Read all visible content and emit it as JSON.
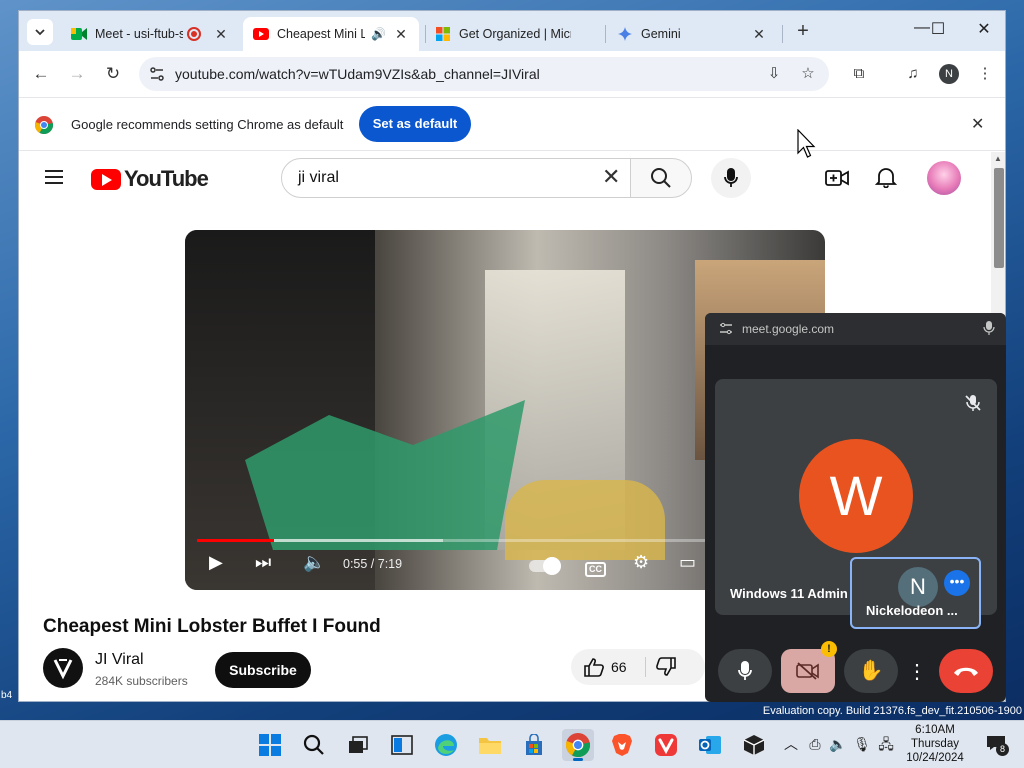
{
  "browser": {
    "tabs": [
      {
        "label": "Meet - usi-ftub-s",
        "active": false
      },
      {
        "label": "Cheapest Mini Lo",
        "active": true
      },
      {
        "label": "Get Organized | Micr",
        "active": false
      },
      {
        "label": "Gemini",
        "active": false
      }
    ],
    "new_tab": "+",
    "url": "youtube.com/watch?v=wTUdam9VZIs&ab_channel=JIViral",
    "profile_initial": "N",
    "infobar": {
      "message": "Google recommends setting Chrome as default",
      "button": "Set as default"
    }
  },
  "youtube": {
    "search_value": "ji viral",
    "player": {
      "time": "0:55 / 7:19",
      "progress_fraction": 0.125,
      "buffer_fraction": 0.4
    },
    "video_title": "Cheapest Mini Lobster Buffet I Found",
    "channel_name": "JI Viral",
    "subscribers": "284K subscribers",
    "subscribe_label": "Subscribe",
    "likes": "66"
  },
  "meet_pip": {
    "origin": "meet.google.com",
    "main_tile": {
      "initial": "W",
      "name": "Windows 11 Admin"
    },
    "self_tile": {
      "initial": "N",
      "name": "Nickelodeon ...",
      "more": "•••"
    },
    "warning": "!"
  },
  "desktop": {
    "evaluation_text": "Evaluation copy. Build 21376.fs_dev_fit.210506-1900",
    "side_label": "b4"
  },
  "taskbar": {
    "time": "6:10AM",
    "day": "Thursday",
    "date": "10/24/2024",
    "notification_count": "8"
  },
  "colors": {
    "youtube_red": "#ff0000",
    "chrome_blue": "#0b57d0",
    "meet_hangup": "#ea4335",
    "avatar_w": "#e8531f"
  }
}
